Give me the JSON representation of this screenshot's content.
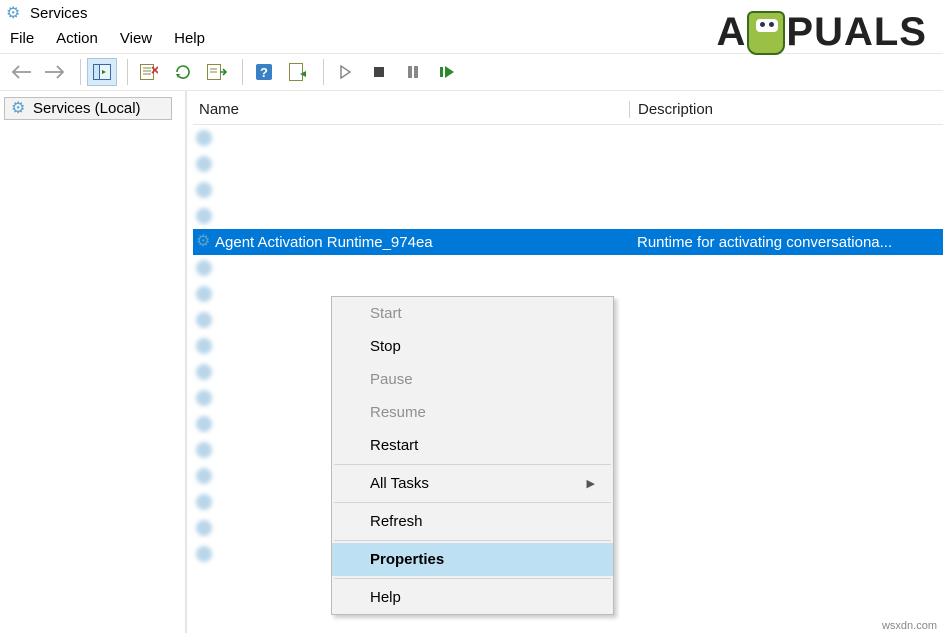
{
  "window": {
    "title": "Services"
  },
  "menubar": {
    "file": "File",
    "action": "Action",
    "view": "View",
    "help": "Help"
  },
  "tree": {
    "root": "Services (Local)"
  },
  "list": {
    "columns": {
      "name": "Name",
      "description": "Description"
    },
    "selected": {
      "name": "Agent Activation Runtime_974ea",
      "description": "Runtime for activating conversationa..."
    }
  },
  "context_menu": {
    "start": "Start",
    "stop": "Stop",
    "pause": "Pause",
    "resume": "Resume",
    "restart": "Restart",
    "all_tasks": "All Tasks",
    "refresh": "Refresh",
    "properties": "Properties",
    "help": "Help"
  },
  "watermark": {
    "text_a": "A",
    "text_rest": "PUALS"
  },
  "source_label": "wsxdn.com"
}
